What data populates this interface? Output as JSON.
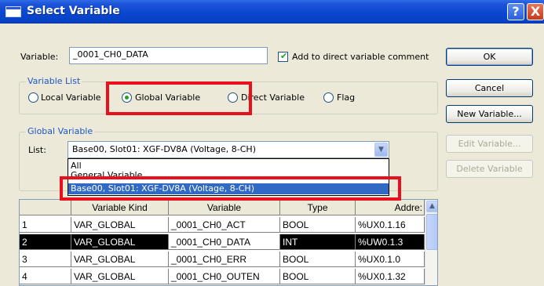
{
  "window": {
    "title": "Select Variable",
    "help_glyph": "?",
    "close_glyph": "X"
  },
  "variable": {
    "label": "Variable:",
    "value": "_0001_CH0_DATA",
    "add_comment_label": "Add to direct variable comment",
    "add_comment_checked": true
  },
  "buttons": {
    "ok": "OK",
    "cancel": "Cancel",
    "new_variable": "New Variable...",
    "edit_variable": "Edit Variable...",
    "delete_variable": "Delete Variable"
  },
  "variable_list": {
    "title": "Variable List",
    "options": [
      "Local Variable",
      "Global Variable",
      "Direct Variable",
      "Flag"
    ],
    "selected": "Global Variable"
  },
  "global_variable": {
    "title": "Global Variable",
    "list_label": "List:",
    "selected": "Base00, Slot01: XGF-DV8A (Voltage, 8-CH)",
    "dropdown_items": [
      "All",
      "General Variable",
      "Base00, Slot01: XGF-DV8A (Voltage, 8-CH)"
    ]
  },
  "table": {
    "columns": [
      "Variable Kind",
      "Variable",
      "Type",
      "Addre:"
    ],
    "rows": [
      {
        "num": "1",
        "kind": "VAR_GLOBAL",
        "variable": "_0001_CH0_ACT",
        "type": "BOOL",
        "address": "%UX0.1.16"
      },
      {
        "num": "2",
        "kind": "VAR_GLOBAL",
        "variable": "_0001_CH0_DATA",
        "type": "INT",
        "address": "%UW0.1.3"
      },
      {
        "num": "3",
        "kind": "VAR_GLOBAL",
        "variable": "_0001_CH0_ERR",
        "type": "BOOL",
        "address": "%UX0.1.0"
      },
      {
        "num": "4",
        "kind": "VAR_GLOBAL",
        "variable": "_0001_CH0_OUTEN",
        "type": "BOOL",
        "address": "%UX0.1.32"
      }
    ],
    "selected_row": 2
  },
  "colors": {
    "title_bar": "#0A46CE",
    "highlight": "#E8101C",
    "selection": "#316AC5",
    "accent_label": "#1E56C8"
  }
}
